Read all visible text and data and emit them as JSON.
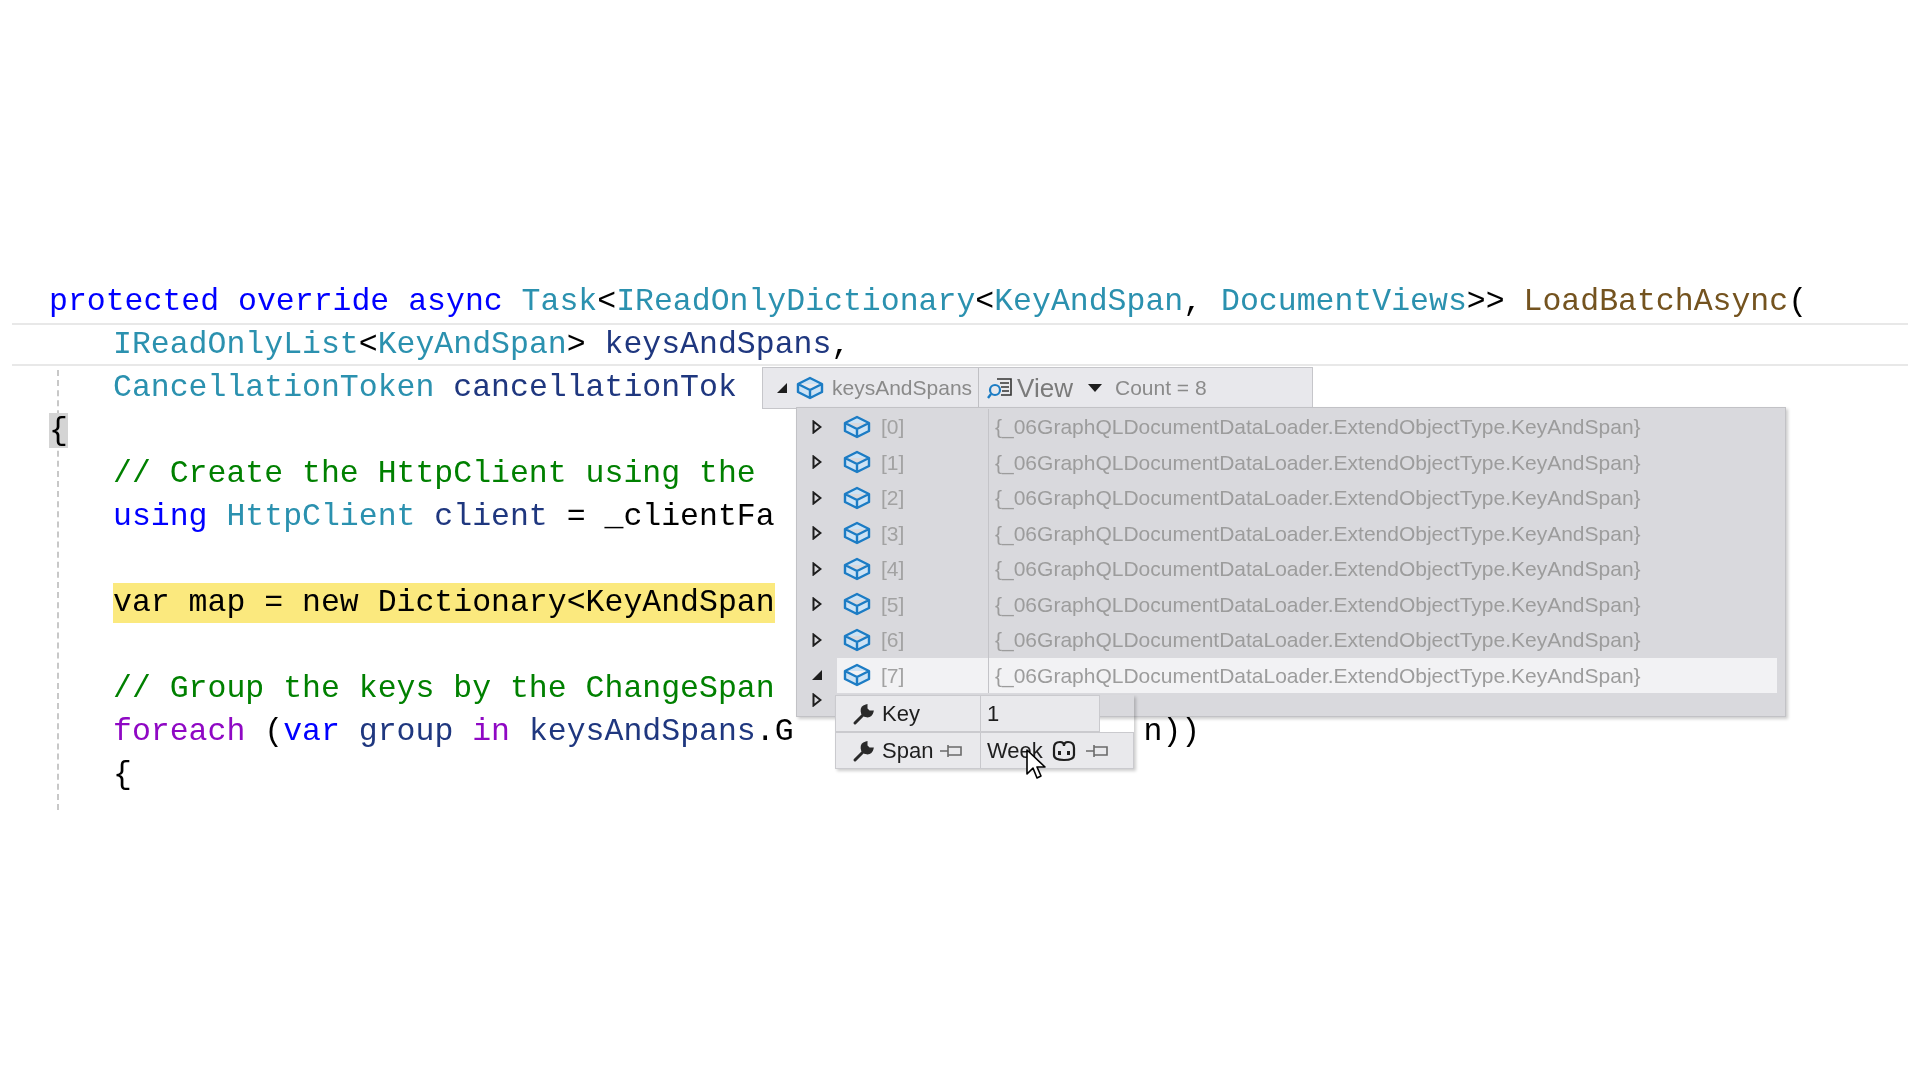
{
  "code_lines": [
    {
      "kind": "code",
      "indented": false,
      "tokens": [
        {
          "text": "protected ",
          "kind": "keyword"
        },
        {
          "text": "override ",
          "kind": "keyword"
        },
        {
          "text": "async ",
          "kind": "keyword"
        },
        {
          "text": "Task",
          "kind": "type"
        },
        {
          "text": "<",
          "kind": "plain"
        },
        {
          "text": "IReadOnlyDictionary",
          "kind": "type"
        },
        {
          "text": "<",
          "kind": "plain"
        },
        {
          "text": "KeyAndSpan",
          "kind": "type"
        },
        {
          "text": ", ",
          "kind": "plain"
        },
        {
          "text": "DocumentViews",
          "kind": "type"
        },
        {
          "text": ">> ",
          "kind": "plain"
        },
        {
          "text": "LoadBatchAsync",
          "kind": "method"
        },
        {
          "text": "(",
          "kind": "plain"
        }
      ]
    },
    {
      "kind": "current",
      "indented": true,
      "tokens": [
        {
          "text": "IReadOnlyList",
          "kind": "type"
        },
        {
          "text": "<",
          "kind": "plain"
        },
        {
          "text": "KeyAndSpan",
          "kind": "type"
        },
        {
          "text": "> ",
          "kind": "plain"
        },
        {
          "text": "keysAndSpans",
          "kind": "ident"
        },
        {
          "text": ",",
          "kind": "plain"
        }
      ]
    },
    {
      "kind": "code",
      "indented": true,
      "tokens": [
        {
          "text": "CancellationToken ",
          "kind": "type"
        },
        {
          "text": "cancellationTok",
          "kind": "ident"
        }
      ]
    },
    {
      "kind": "code",
      "indented": false,
      "tokens": [
        {
          "text": "{",
          "kind": "brace-match"
        }
      ]
    },
    {
      "kind": "code",
      "indented": true,
      "tokens": [
        {
          "text": "// Create the HttpClient using the",
          "kind": "comment"
        }
      ]
    },
    {
      "kind": "code",
      "indented": true,
      "tokens": [
        {
          "text": "using ",
          "kind": "keyword"
        },
        {
          "text": "HttpClient ",
          "kind": "type"
        },
        {
          "text": "client",
          "kind": "ident"
        },
        {
          "text": " = _clientFa",
          "kind": "plain"
        }
      ]
    },
    {
      "kind": "blank"
    },
    {
      "kind": "highlight",
      "indented": true,
      "tokens": [
        {
          "text": "var map = new Dictionary<KeyAndSpan",
          "kind": "plain"
        }
      ]
    },
    {
      "kind": "blank"
    },
    {
      "kind": "code",
      "indented": true,
      "tokens": [
        {
          "text": "// Group the keys by the ChangeSpan",
          "kind": "comment"
        }
      ]
    },
    {
      "kind": "code",
      "indented": true,
      "tokens": [
        {
          "text": "foreach ",
          "kind": "control"
        },
        {
          "text": "(",
          "kind": "plain"
        },
        {
          "text": "var ",
          "kind": "keyword"
        },
        {
          "text": "group ",
          "kind": "ident"
        },
        {
          "text": "in ",
          "kind": "control"
        },
        {
          "text": "keysAndSpans",
          "kind": "ident"
        },
        {
          "text": ".G",
          "kind": "plain"
        }
      ],
      "tail": "n))"
    },
    {
      "kind": "code",
      "indented": true,
      "tokens": [
        {
          "text": "{",
          "kind": "plain"
        }
      ]
    }
  ],
  "datatip": {
    "expanded": true,
    "name": "keysAndSpans",
    "visualizer": "View",
    "count": "Count = 8",
    "items": [
      {
        "name": "[0]",
        "value": "{_06GraphQLDocumentDataLoader.ExtendObjectType.KeyAndSpan}",
        "expanded": false,
        "selected": false
      },
      {
        "name": "[1]",
        "value": "{_06GraphQLDocumentDataLoader.ExtendObjectType.KeyAndSpan}",
        "expanded": false,
        "selected": false
      },
      {
        "name": "[2]",
        "value": "{_06GraphQLDocumentDataLoader.ExtendObjectType.KeyAndSpan}",
        "expanded": false,
        "selected": false
      },
      {
        "name": "[3]",
        "value": "{_06GraphQLDocumentDataLoader.ExtendObjectType.KeyAndSpan}",
        "expanded": false,
        "selected": false
      },
      {
        "name": "[4]",
        "value": "{_06GraphQLDocumentDataLoader.ExtendObjectType.KeyAndSpan}",
        "expanded": false,
        "selected": false
      },
      {
        "name": "[5]",
        "value": "{_06GraphQLDocumentDataLoader.ExtendObjectType.KeyAndSpan}",
        "expanded": false,
        "selected": false
      },
      {
        "name": "[6]",
        "value": "{_06GraphQLDocumentDataLoader.ExtendObjectType.KeyAndSpan}",
        "expanded": false,
        "selected": false
      },
      {
        "name": "[7]",
        "value": "{_06GraphQLDocumentDataLoader.ExtendObjectType.KeyAndSpan}",
        "expanded": true,
        "selected": true,
        "children": [
          {
            "name": "Key",
            "value": "1",
            "hovered": false
          },
          {
            "name": "Span",
            "value": "Week",
            "hovered": true
          }
        ]
      }
    ]
  }
}
